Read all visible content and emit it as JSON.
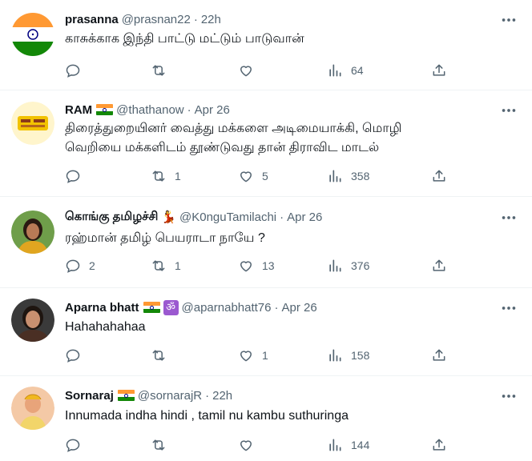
{
  "colors": {
    "text": "#0f1419",
    "secondary": "#536471",
    "divider": "#eff3f4",
    "om_badge": "#9b59d0"
  },
  "icons": {
    "reply": "reply-icon",
    "retweet": "retweet-icon",
    "like": "heart-icon",
    "views": "views-icon",
    "share": "share-icon",
    "more": "more-icon"
  },
  "tweets": [
    {
      "name": "prasanna",
      "handle": "@prasnan22",
      "time": "22h",
      "badges": [],
      "lines": [
        "காசுக்காக இந்தி பாட்டு மட்டும் பாடுவான்"
      ],
      "replies": "",
      "retweets": "",
      "likes": "",
      "views": "64"
    },
    {
      "name": "RAM",
      "handle": "@thathanow",
      "time": "Apr 26",
      "badges": [
        "india-flag"
      ],
      "lines": [
        "திரைத்துறையினர் வைத்து மக்களை அடிமையாக்கி, மொழி",
        "வெறியை மக்களிடம் தூண்டுவது தான் திராவிட மாடல்"
      ],
      "replies": "",
      "retweets": "1",
      "likes": "5",
      "views": "358"
    },
    {
      "name": "கொங்கு தமிழச்சி",
      "handle": "@K0nguTamilachi",
      "time": "Apr 26",
      "badges": [
        "dancer"
      ],
      "lines": [
        "ரஹ்மான் தமிழ் பெயராடா நாயே ?"
      ],
      "replies": "2",
      "retweets": "1",
      "likes": "13",
      "views": "376"
    },
    {
      "name": "Aparna bhatt",
      "handle": "@aparnabhatt76",
      "time": "Apr 26",
      "badges": [
        "india-flag",
        "om"
      ],
      "lines": [
        "Hahahahahaa"
      ],
      "replies": "",
      "retweets": "",
      "likes": "1",
      "views": "158"
    },
    {
      "name": "Sornaraj",
      "handle": "@sornarajR",
      "time": "22h",
      "badges": [
        "india-flag"
      ],
      "lines": [
        "Innumada indha hindi , tamil nu kambu suthuringa"
      ],
      "replies": "",
      "retweets": "",
      "likes": "",
      "views": "144"
    }
  ],
  "badge_glyphs": {
    "om": "ॐ",
    "dancer": "💃"
  }
}
